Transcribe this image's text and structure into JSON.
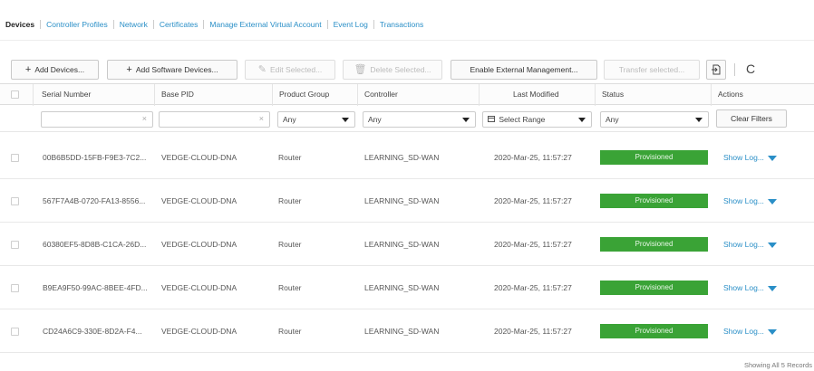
{
  "tabs": [
    {
      "label": "Devices",
      "active": true
    },
    {
      "label": "Controller Profiles"
    },
    {
      "label": "Network"
    },
    {
      "label": "Certificates"
    },
    {
      "label": "Manage External Virtual Account"
    },
    {
      "label": "Event Log"
    },
    {
      "label": "Transactions"
    }
  ],
  "toolbar": {
    "add_devices": "Add Devices...",
    "add_software_devices": "Add Software Devices...",
    "edit_selected": "Edit Selected...",
    "delete_selected": "Delete Selected...",
    "enable_external": "Enable External Management...",
    "transfer_selected": "Transfer selected...",
    "plus_glyph": "+",
    "edit_glyph": "✎",
    "delete_glyph": "🗑",
    "refresh_glyph": "C"
  },
  "columns": {
    "serial": "Serial Number",
    "base_pid": "Base PID",
    "product_group": "Product Group",
    "controller": "Controller",
    "last_modified": "Last Modified",
    "status": "Status",
    "actions": "Actions"
  },
  "filters": {
    "product_group": "Any",
    "controller": "Any",
    "last_modified": "Select Range",
    "status": "Any",
    "clear_filters": "Clear Filters",
    "clear_glyph": "×"
  },
  "rows": [
    {
      "serial": "00B6B5DD-15FB-F9E3-7C2...",
      "pid": "VEDGE-CLOUD-DNA",
      "group": "Router",
      "controller": "LEARNING_SD-WAN",
      "modified": "2020-Mar-25, 11:57:27",
      "status": "Provisioned",
      "action": "Show Log..."
    },
    {
      "serial": "567F7A4B-0720-FA13-8556...",
      "pid": "VEDGE-CLOUD-DNA",
      "group": "Router",
      "controller": "LEARNING_SD-WAN",
      "modified": "2020-Mar-25, 11:57:27",
      "status": "Provisioned",
      "action": "Show Log..."
    },
    {
      "serial": "60380EF5-8D8B-C1CA-26D...",
      "pid": "VEDGE-CLOUD-DNA",
      "group": "Router",
      "controller": "LEARNING_SD-WAN",
      "modified": "2020-Mar-25, 11:57:27",
      "status": "Provisioned",
      "action": "Show Log..."
    },
    {
      "serial": "B9EA9F50-99AC-8BEE-4FD...",
      "pid": "VEDGE-CLOUD-DNA",
      "group": "Router",
      "controller": "LEARNING_SD-WAN",
      "modified": "2020-Mar-25, 11:57:27",
      "status": "Provisioned",
      "action": "Show Log..."
    },
    {
      "serial": "CD24A6C9-330E-8D2A-F4...",
      "pid": "VEDGE-CLOUD-DNA",
      "group": "Router",
      "controller": "LEARNING_SD-WAN",
      "modified": "2020-Mar-25, 11:57:27",
      "status": "Provisioned",
      "action": "Show Log..."
    }
  ],
  "footer": {
    "records": "Showing All 5 Records"
  },
  "colors": {
    "accent": "#2a8fc7",
    "provisioned": "#3aa336"
  }
}
